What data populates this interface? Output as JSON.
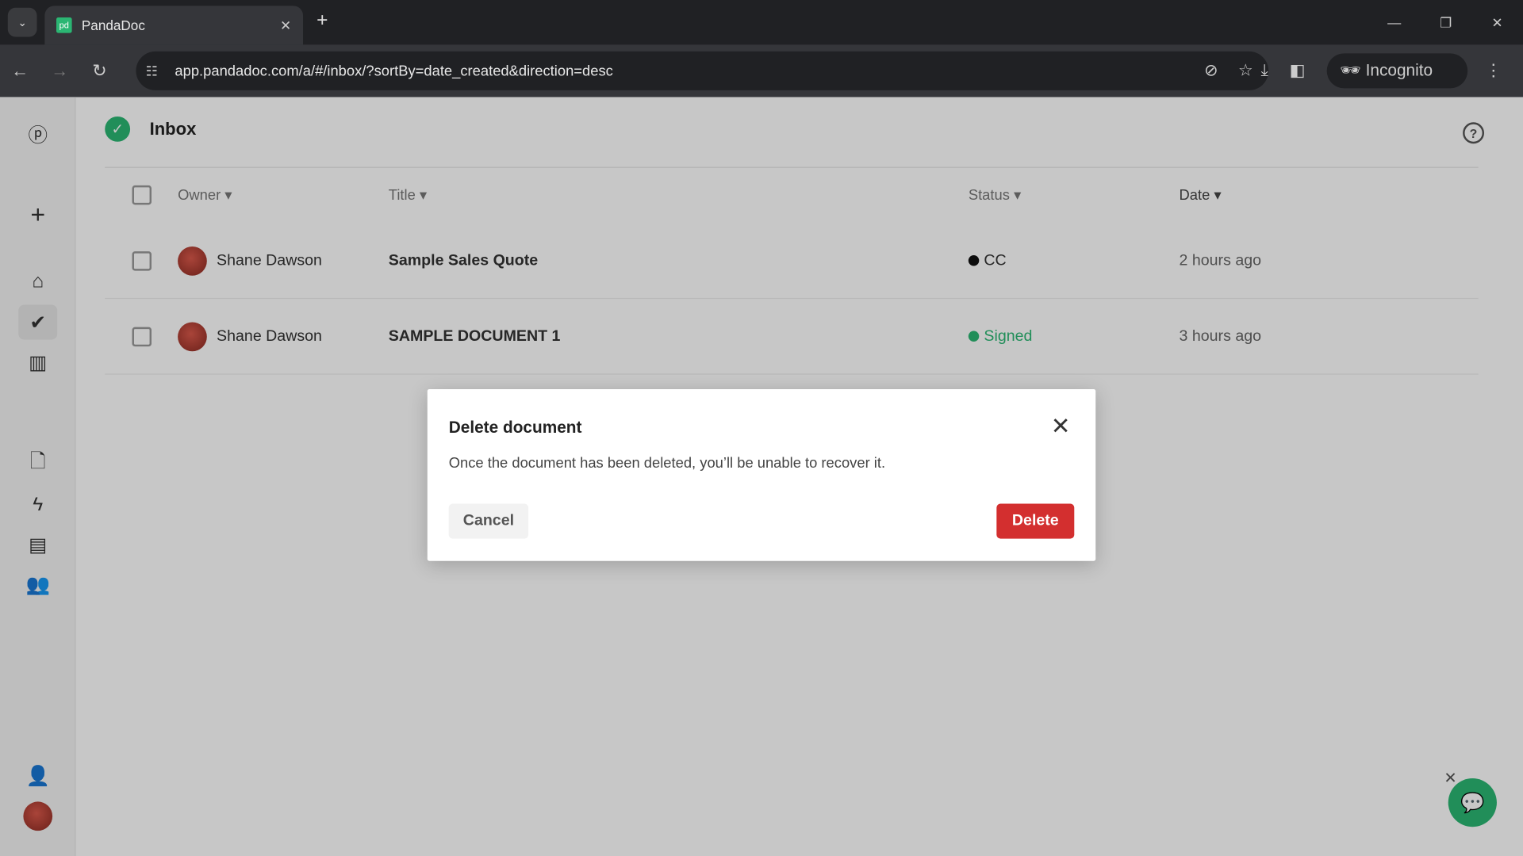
{
  "browser": {
    "tab_title": "PandaDoc",
    "favicon": "pd",
    "url": "app.pandadoc.com/a/#/inbox/?sortBy=date_created&direction=desc",
    "profile": "Incognito"
  },
  "header": {
    "title": "Inbox"
  },
  "table": {
    "columns": [
      "Owner",
      "Title",
      "Status",
      "Date"
    ],
    "rows": [
      {
        "owner": "Shane Dawson",
        "title": "Sample Sales Quote",
        "status": "CC",
        "status_color": "#111111",
        "date": "2 hours ago"
      },
      {
        "owner": "Shane Dawson",
        "title": "SAMPLE DOCUMENT 1",
        "status": "Signed",
        "status_color": "#2bb673",
        "date": "3 hours ago"
      }
    ]
  },
  "modal": {
    "title": "Delete document",
    "message": "Once the document has been deleted, you’ll be unable to recover it.",
    "cancel": "Cancel",
    "confirm": "Delete"
  },
  "colors": {
    "brand": "#2bb673",
    "danger": "#d32f2f"
  }
}
